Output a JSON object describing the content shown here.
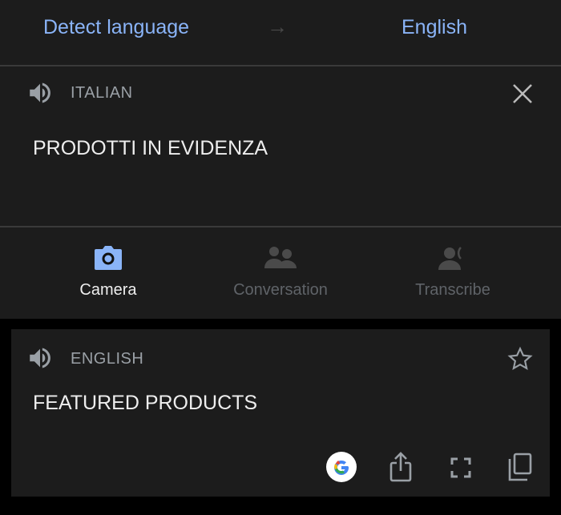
{
  "header": {
    "source_language": "Detect language",
    "target_language": "English",
    "swap_icon": "arrow-right-icon"
  },
  "input": {
    "language_label": "ITALIAN",
    "text": "PRODOTTI IN EVIDENZA"
  },
  "modes": [
    {
      "label": "Camera",
      "icon": "camera-icon",
      "active": true
    },
    {
      "label": "Conversation",
      "icon": "people-icon",
      "active": false
    },
    {
      "label": "Transcribe",
      "icon": "transcribe-icon",
      "active": false
    }
  ],
  "output": {
    "language_label": "ENGLISH",
    "text": "FEATURED PRODUCTS"
  },
  "colors": {
    "accent": "#8ab4f8",
    "background": "#1c1c1c",
    "muted": "#5f6368"
  }
}
